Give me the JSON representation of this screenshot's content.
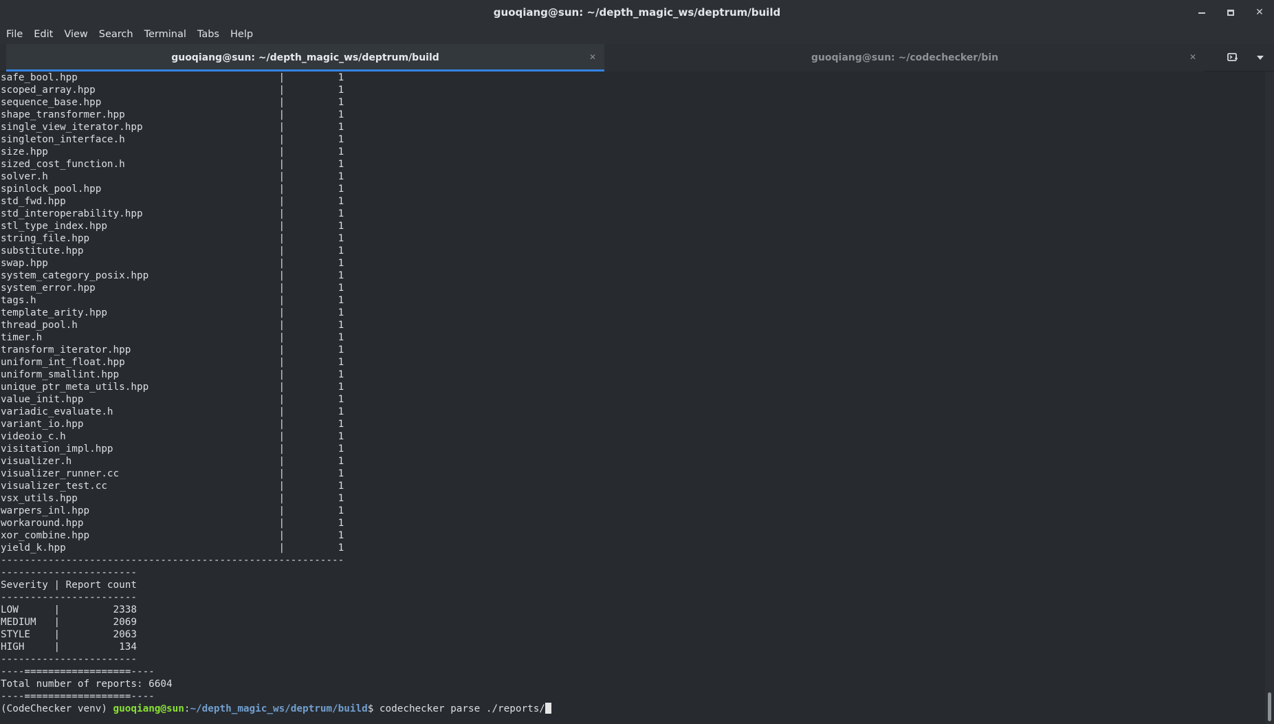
{
  "window": {
    "title": "guoqiang@sun: ~/depth_magic_ws/deptrum/build"
  },
  "menu": [
    "File",
    "Edit",
    "View",
    "Search",
    "Terminal",
    "Tabs",
    "Help"
  ],
  "tabs": [
    {
      "label": "guoqiang@sun: ~/depth_magic_ws/deptrum/build",
      "active": true
    },
    {
      "label": "guoqiang@sun: ~/codechecker/bin",
      "active": false
    }
  ],
  "terminal": {
    "file_rows": [
      {
        "file": "safe_bool.hpp",
        "count": "1"
      },
      {
        "file": "scoped_array.hpp",
        "count": "1"
      },
      {
        "file": "sequence_base.hpp",
        "count": "1"
      },
      {
        "file": "shape_transformer.hpp",
        "count": "1"
      },
      {
        "file": "single_view_iterator.hpp",
        "count": "1"
      },
      {
        "file": "singleton_interface.h",
        "count": "1"
      },
      {
        "file": "size.hpp",
        "count": "1"
      },
      {
        "file": "sized_cost_function.h",
        "count": "1"
      },
      {
        "file": "solver.h",
        "count": "1"
      },
      {
        "file": "spinlock_pool.hpp",
        "count": "1"
      },
      {
        "file": "std_fwd.hpp",
        "count": "1"
      },
      {
        "file": "std_interoperability.hpp",
        "count": "1"
      },
      {
        "file": "stl_type_index.hpp",
        "count": "1"
      },
      {
        "file": "string_file.hpp",
        "count": "1"
      },
      {
        "file": "substitute.hpp",
        "count": "1"
      },
      {
        "file": "swap.hpp",
        "count": "1"
      },
      {
        "file": "system_category_posix.hpp",
        "count": "1"
      },
      {
        "file": "system_error.hpp",
        "count": "1"
      },
      {
        "file": "tags.h",
        "count": "1"
      },
      {
        "file": "template_arity.hpp",
        "count": "1"
      },
      {
        "file": "thread_pool.h",
        "count": "1"
      },
      {
        "file": "timer.h",
        "count": "1"
      },
      {
        "file": "transform_iterator.hpp",
        "count": "1"
      },
      {
        "file": "uniform_int_float.hpp",
        "count": "1"
      },
      {
        "file": "uniform_smallint.hpp",
        "count": "1"
      },
      {
        "file": "unique_ptr_meta_utils.hpp",
        "count": "1"
      },
      {
        "file": "value_init.hpp",
        "count": "1"
      },
      {
        "file": "variadic_evaluate.h",
        "count": "1"
      },
      {
        "file": "variant_io.hpp",
        "count": "1"
      },
      {
        "file": "videoio_c.h",
        "count": "1"
      },
      {
        "file": "visitation_impl.hpp",
        "count": "1"
      },
      {
        "file": "visualizer.h",
        "count": "1"
      },
      {
        "file": "visualizer_runner.cc",
        "count": "1"
      },
      {
        "file": "visualizer_test.cc",
        "count": "1"
      },
      {
        "file": "vsx_utils.hpp",
        "count": "1"
      },
      {
        "file": "warpers_inl.hpp",
        "count": "1"
      },
      {
        "file": "workaround.hpp",
        "count": "1"
      },
      {
        "file": "xor_combine.hpp",
        "count": "1"
      },
      {
        "file": "yield_k.hpp",
        "count": "1"
      }
    ],
    "file_table_separator": "----------------------------------------------------------",
    "severity_separator": "-----------------------",
    "severity_header": "Severity | Report count",
    "severity_rows": [
      {
        "severity": "LOW",
        "count": "2338"
      },
      {
        "severity": "MEDIUM",
        "count": "2069"
      },
      {
        "severity": "STYLE",
        "count": "2063"
      },
      {
        "severity": "HIGH",
        "count": "134"
      }
    ],
    "total_separator": "----==================----",
    "total_line": "Total number of reports: 6604",
    "prompt": {
      "venv": "(CodeChecker venv) ",
      "user_host": "guoqiang@sun",
      "colon": ":",
      "path": "~/depth_magic_ws/deptrum/build",
      "dollar": "$ ",
      "command": "codechecker parse ./reports/"
    }
  }
}
